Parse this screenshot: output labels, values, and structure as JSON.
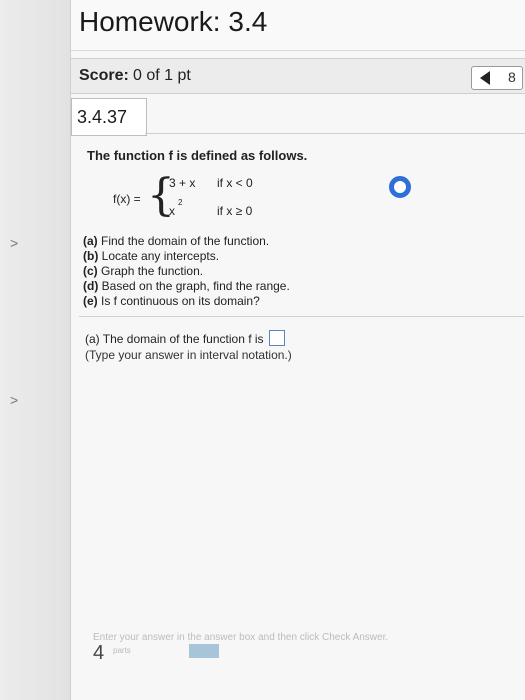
{
  "header": {
    "title": "Homework: 3.4"
  },
  "score": {
    "label": "Score:",
    "value": "0 of 1 pt"
  },
  "nav": {
    "next_label": "8"
  },
  "question": {
    "number": "3.4.37",
    "intro": "The function f is defined as follows.",
    "function": {
      "label": "f(x) =",
      "case1_expr": "3 + x",
      "case1_cond": "if x < 0",
      "case2_expr": "x",
      "case2_exp": "2",
      "case2_cond": "if x ≥ 0"
    },
    "parts": [
      {
        "tag": "(a)",
        "text": "Find the domain of the function."
      },
      {
        "tag": "(b)",
        "text": "Locate any intercepts."
      },
      {
        "tag": "(c)",
        "text": "Graph the function."
      },
      {
        "tag": "(d)",
        "text": "Based on the graph, find the range."
      },
      {
        "tag": "(e)",
        "text": "Is f continuous on its domain?"
      }
    ],
    "answer": {
      "prompt": "(a) The domain of the function f is",
      "hint": "(Type your answer in interval notation.)"
    }
  },
  "footer": {
    "hint": "Enter your answer in the answer box and then click Check Answer.",
    "parts_count": "4",
    "parts_label": "parts"
  },
  "colors": {
    "accent": "#2e6fd8",
    "box_border": "#5a82c9"
  },
  "icons": {
    "nav_prev": "triangle-left-icon",
    "status": "circle-icon",
    "gutter": "chevron-right-icon"
  }
}
